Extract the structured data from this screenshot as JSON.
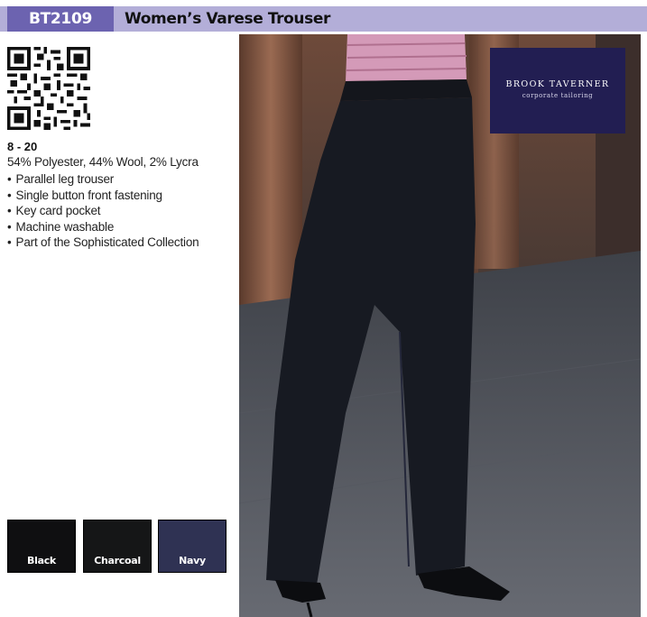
{
  "header": {
    "code": "BT2109",
    "title": "Women’s Varese Trouser"
  },
  "product": {
    "size_range": "8 - 20",
    "composition": "54% Polyester, 44% Wool, 2% Lycra",
    "features": [
      "Parallel leg trouser",
      "Single button front fastening",
      "Key card pocket",
      "Machine washable",
      "Part of the Sophisticated Collection"
    ]
  },
  "colours": [
    {
      "name": "Black",
      "hex": "#0f0f11"
    },
    {
      "name": "Charcoal",
      "hex": "#151617"
    },
    {
      "name": "Navy",
      "hex": "#2f3253"
    }
  ],
  "brand": {
    "name": "BROOK TAVERNER",
    "tagline": "corporate tailoring"
  },
  "theme": {
    "header_band": "#b3aed8",
    "code_box": "#6c63b0",
    "brand_box": "#221e52"
  }
}
